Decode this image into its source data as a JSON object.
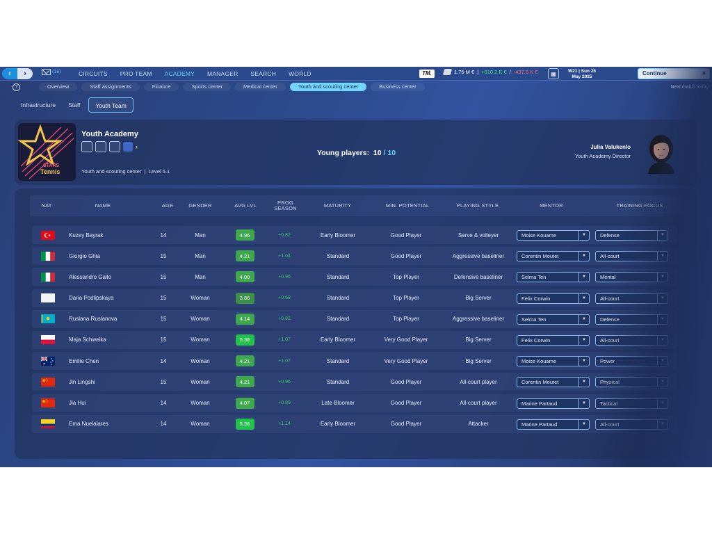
{
  "topbar": {
    "mail_count": "(18)",
    "nav": [
      "CIRCUITS",
      "PRO TEAM",
      "ACADEMY",
      "MANAGER",
      "SEARCH",
      "WORLD"
    ],
    "active_nav": 2,
    "tm_logo": "TM.",
    "balance": "1.75 M €",
    "income": "+610.2 K €",
    "expense": "-437.6 K €",
    "date_line1": "W21 | Sun 25",
    "date_line2": "May 2025",
    "continue_label": "Continue",
    "next_match": "Next match today"
  },
  "subnav": {
    "items": [
      "Overview",
      "Staff assignments",
      "Finance",
      "Sports center",
      "Medical center",
      "Youth and scouting center",
      "Business center"
    ],
    "active": 5
  },
  "tabs": {
    "items": [
      "Infrastructure",
      "Staff",
      "Youth Team"
    ],
    "active": 2
  },
  "academy": {
    "logo_line1": "STARS",
    "logo_line2": "Tennis",
    "title": "Youth Academy",
    "facility": "Youth and scouting center",
    "separator": "|",
    "level": "Level 5.1",
    "young_label": "Young players:",
    "young_current": "10",
    "young_slash": "/",
    "young_max": "10",
    "director_name": "Julia Valukenlo",
    "director_role": "Youth Academy Director"
  },
  "table": {
    "headers": {
      "nat": "NAT",
      "name": "NAME",
      "age": "AGE",
      "gender": "GENDER",
      "avg_lvl": "AVG LVL",
      "prog_1": "PROG",
      "prog_2": "SEASON",
      "maturity": "MATURITY",
      "potential": "MIN. POTENTIAL",
      "style": "PLAYING STYLE",
      "mentor": "MENTOR",
      "focus": "TRAINING FOCUS"
    },
    "rows": [
      {
        "flag": "turkey",
        "name": "Kuzey Bayrak",
        "age": "14",
        "gender": "Man",
        "lvl": "4.96",
        "lvl_color": "#3fa84f",
        "prog": "+0.82",
        "maturity": "Early Bloomer",
        "potential": "Good Player",
        "style": "Serve & volleyer",
        "mentor": "Moise Kouame",
        "focus": "Defense"
      },
      {
        "flag": "italy",
        "name": "Giorgio Ghia",
        "age": "15",
        "gender": "Man",
        "lvl": "4.21",
        "lvl_color": "#3fa84f",
        "prog": "+1.04",
        "maturity": "Standard",
        "potential": "Good Player",
        "style": "Aggressive baseliner",
        "mentor": "Corentin Moutet",
        "focus": "All-court"
      },
      {
        "flag": "italy",
        "name": "Alessandro Gallo",
        "age": "15",
        "gender": "Man",
        "lvl": "4.00",
        "lvl_color": "#3fa84f",
        "prog": "+0.96",
        "maturity": "Standard",
        "potential": "Top Player",
        "style": "Defensive baseliner",
        "mentor": "Selma Ten",
        "focus": "Mental"
      },
      {
        "flag": "white",
        "name": "Daria Podlipskaya",
        "age": "15",
        "gender": "Woman",
        "lvl": "3.86",
        "lvl_color": "#3b8f47",
        "prog": "+0.68",
        "maturity": "Standard",
        "potential": "Top Player",
        "style": "Big Server",
        "mentor": "Felix Corwin",
        "focus": "All-court"
      },
      {
        "flag": "kazakhstan",
        "name": "Ruslana Ruslanova",
        "age": "15",
        "gender": "Woman",
        "lvl": "4.14",
        "lvl_color": "#3fa84f",
        "prog": "+0.82",
        "maturity": "Standard",
        "potential": "Top Player",
        "style": "Aggressive baseliner",
        "mentor": "Selma Ten",
        "focus": "Defense"
      },
      {
        "flag": "poland",
        "name": "Maja Schweika",
        "age": "15",
        "gender": "Woman",
        "lvl": "5.36",
        "lvl_color": "#22c24b",
        "prog": "+1.07",
        "maturity": "Early Bloomer",
        "potential": "Very Good Player",
        "style": "Big Server",
        "mentor": "Felix Corwin",
        "focus": "All-court"
      },
      {
        "flag": "australia",
        "name": "Emilie Chen",
        "age": "14",
        "gender": "Woman",
        "lvl": "4.21",
        "lvl_color": "#3fa84f",
        "prog": "+1.07",
        "maturity": "Standard",
        "potential": "Very Good Player",
        "style": "Big Server",
        "mentor": "Moise Kouame",
        "focus": "Power"
      },
      {
        "flag": "china",
        "name": "Jin Lingshi",
        "age": "15",
        "gender": "Woman",
        "lvl": "4.21",
        "lvl_color": "#3fa84f",
        "prog": "+0.96",
        "maturity": "Standard",
        "potential": "Good Player",
        "style": "All-court player",
        "mentor": "Corentin Moutet",
        "focus": "Physical"
      },
      {
        "flag": "china",
        "name": "Jia Hui",
        "age": "14",
        "gender": "Woman",
        "lvl": "4.07",
        "lvl_color": "#3fa84f",
        "prog": "+0.89",
        "maturity": "Late Bloomer",
        "potential": "Good Player",
        "style": "All-court player",
        "mentor": "Marine Partaud",
        "focus": "Tactical"
      },
      {
        "flag": "colombia",
        "name": "Ema Nuelalares",
        "age": "14",
        "gender": "Woman",
        "lvl": "5.36",
        "lvl_color": "#22c24b",
        "prog": "+1.14",
        "maturity": "Early Bloomer",
        "potential": "Good Player",
        "style": "Attacker",
        "mentor": "Marine Partaud",
        "focus": "All-court"
      }
    ]
  }
}
